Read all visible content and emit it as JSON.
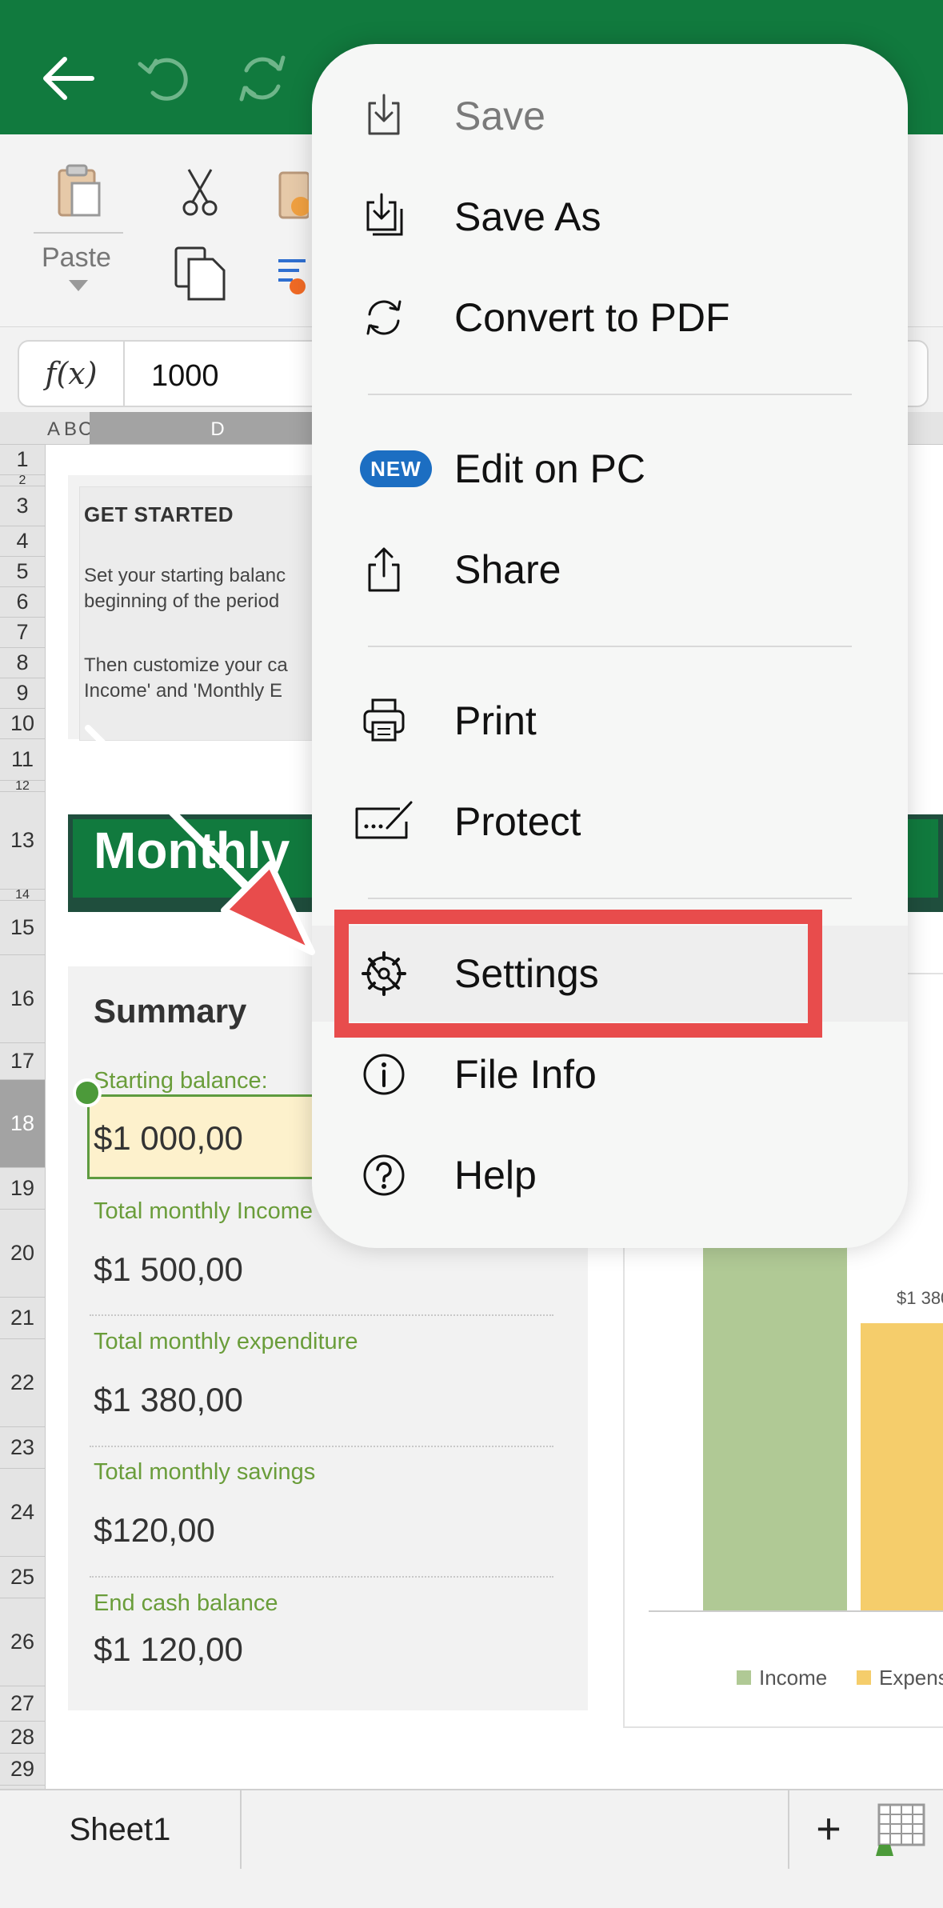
{
  "formula_bar": {
    "fx_label": "f(x)",
    "value": "1000"
  },
  "ribbon": {
    "paste_label": "Paste"
  },
  "columns": [
    "A",
    "B",
    "C",
    "D"
  ],
  "rows": [
    "1",
    "2",
    "3",
    "4",
    "5",
    "6",
    "7",
    "8",
    "9",
    "10",
    "11",
    "12",
    "13",
    "14",
    "15",
    "16",
    "17",
    "18",
    "19",
    "20",
    "21",
    "22",
    "23",
    "24",
    "25",
    "26",
    "27",
    "28",
    "29"
  ],
  "get_started": {
    "title": "GET STARTED",
    "line1": "Set your starting balanc",
    "line2": "beginning of the period",
    "line3": "Then customize your ca",
    "line4": "Income' and 'Monthly E"
  },
  "banner": {
    "title": "Monthly"
  },
  "summary": {
    "title": "Summary",
    "starting_label": "Starting balance:",
    "starting_value": "$1 000,00",
    "income_label": "Total monthly Income",
    "income_value": "$1 500,00",
    "expenditure_label": "Total monthly expenditure",
    "expenditure_value": "$1 380,00",
    "savings_label": "Total monthly savings",
    "savings_value": "$120,00",
    "end_label": "End cash balance",
    "end_value": "$1 120,00"
  },
  "chart_data": {
    "type": "bar",
    "categories": [
      "Income",
      "Expens"
    ],
    "values": [
      1500,
      1380
    ],
    "data_labels": [
      "",
      "$1 380"
    ],
    "legend": [
      "Income",
      "Expens"
    ],
    "colors": [
      "#b0c995",
      "#f5cd6b"
    ]
  },
  "menu": {
    "items": [
      {
        "label": "Save",
        "icon": "save-icon",
        "disabled": true
      },
      {
        "label": "Save As",
        "icon": "save-as-icon"
      },
      {
        "label": "Convert to PDF",
        "icon": "convert-icon"
      },
      {
        "label": "Edit on PC",
        "icon": "new-badge",
        "badge": "NEW"
      },
      {
        "label": "Share",
        "icon": "share-icon"
      },
      {
        "label": "Print",
        "icon": "printer-icon"
      },
      {
        "label": "Protect",
        "icon": "signature-icon"
      },
      {
        "label": "Settings",
        "icon": "gear-icon"
      },
      {
        "label": "File Info",
        "icon": "info-icon"
      },
      {
        "label": "Help",
        "icon": "help-icon"
      }
    ]
  },
  "tabs": {
    "sheet1": "Sheet1",
    "add": "+"
  },
  "colors": {
    "excel_green": "#117a3e",
    "highlight_red": "#e84c4c"
  }
}
